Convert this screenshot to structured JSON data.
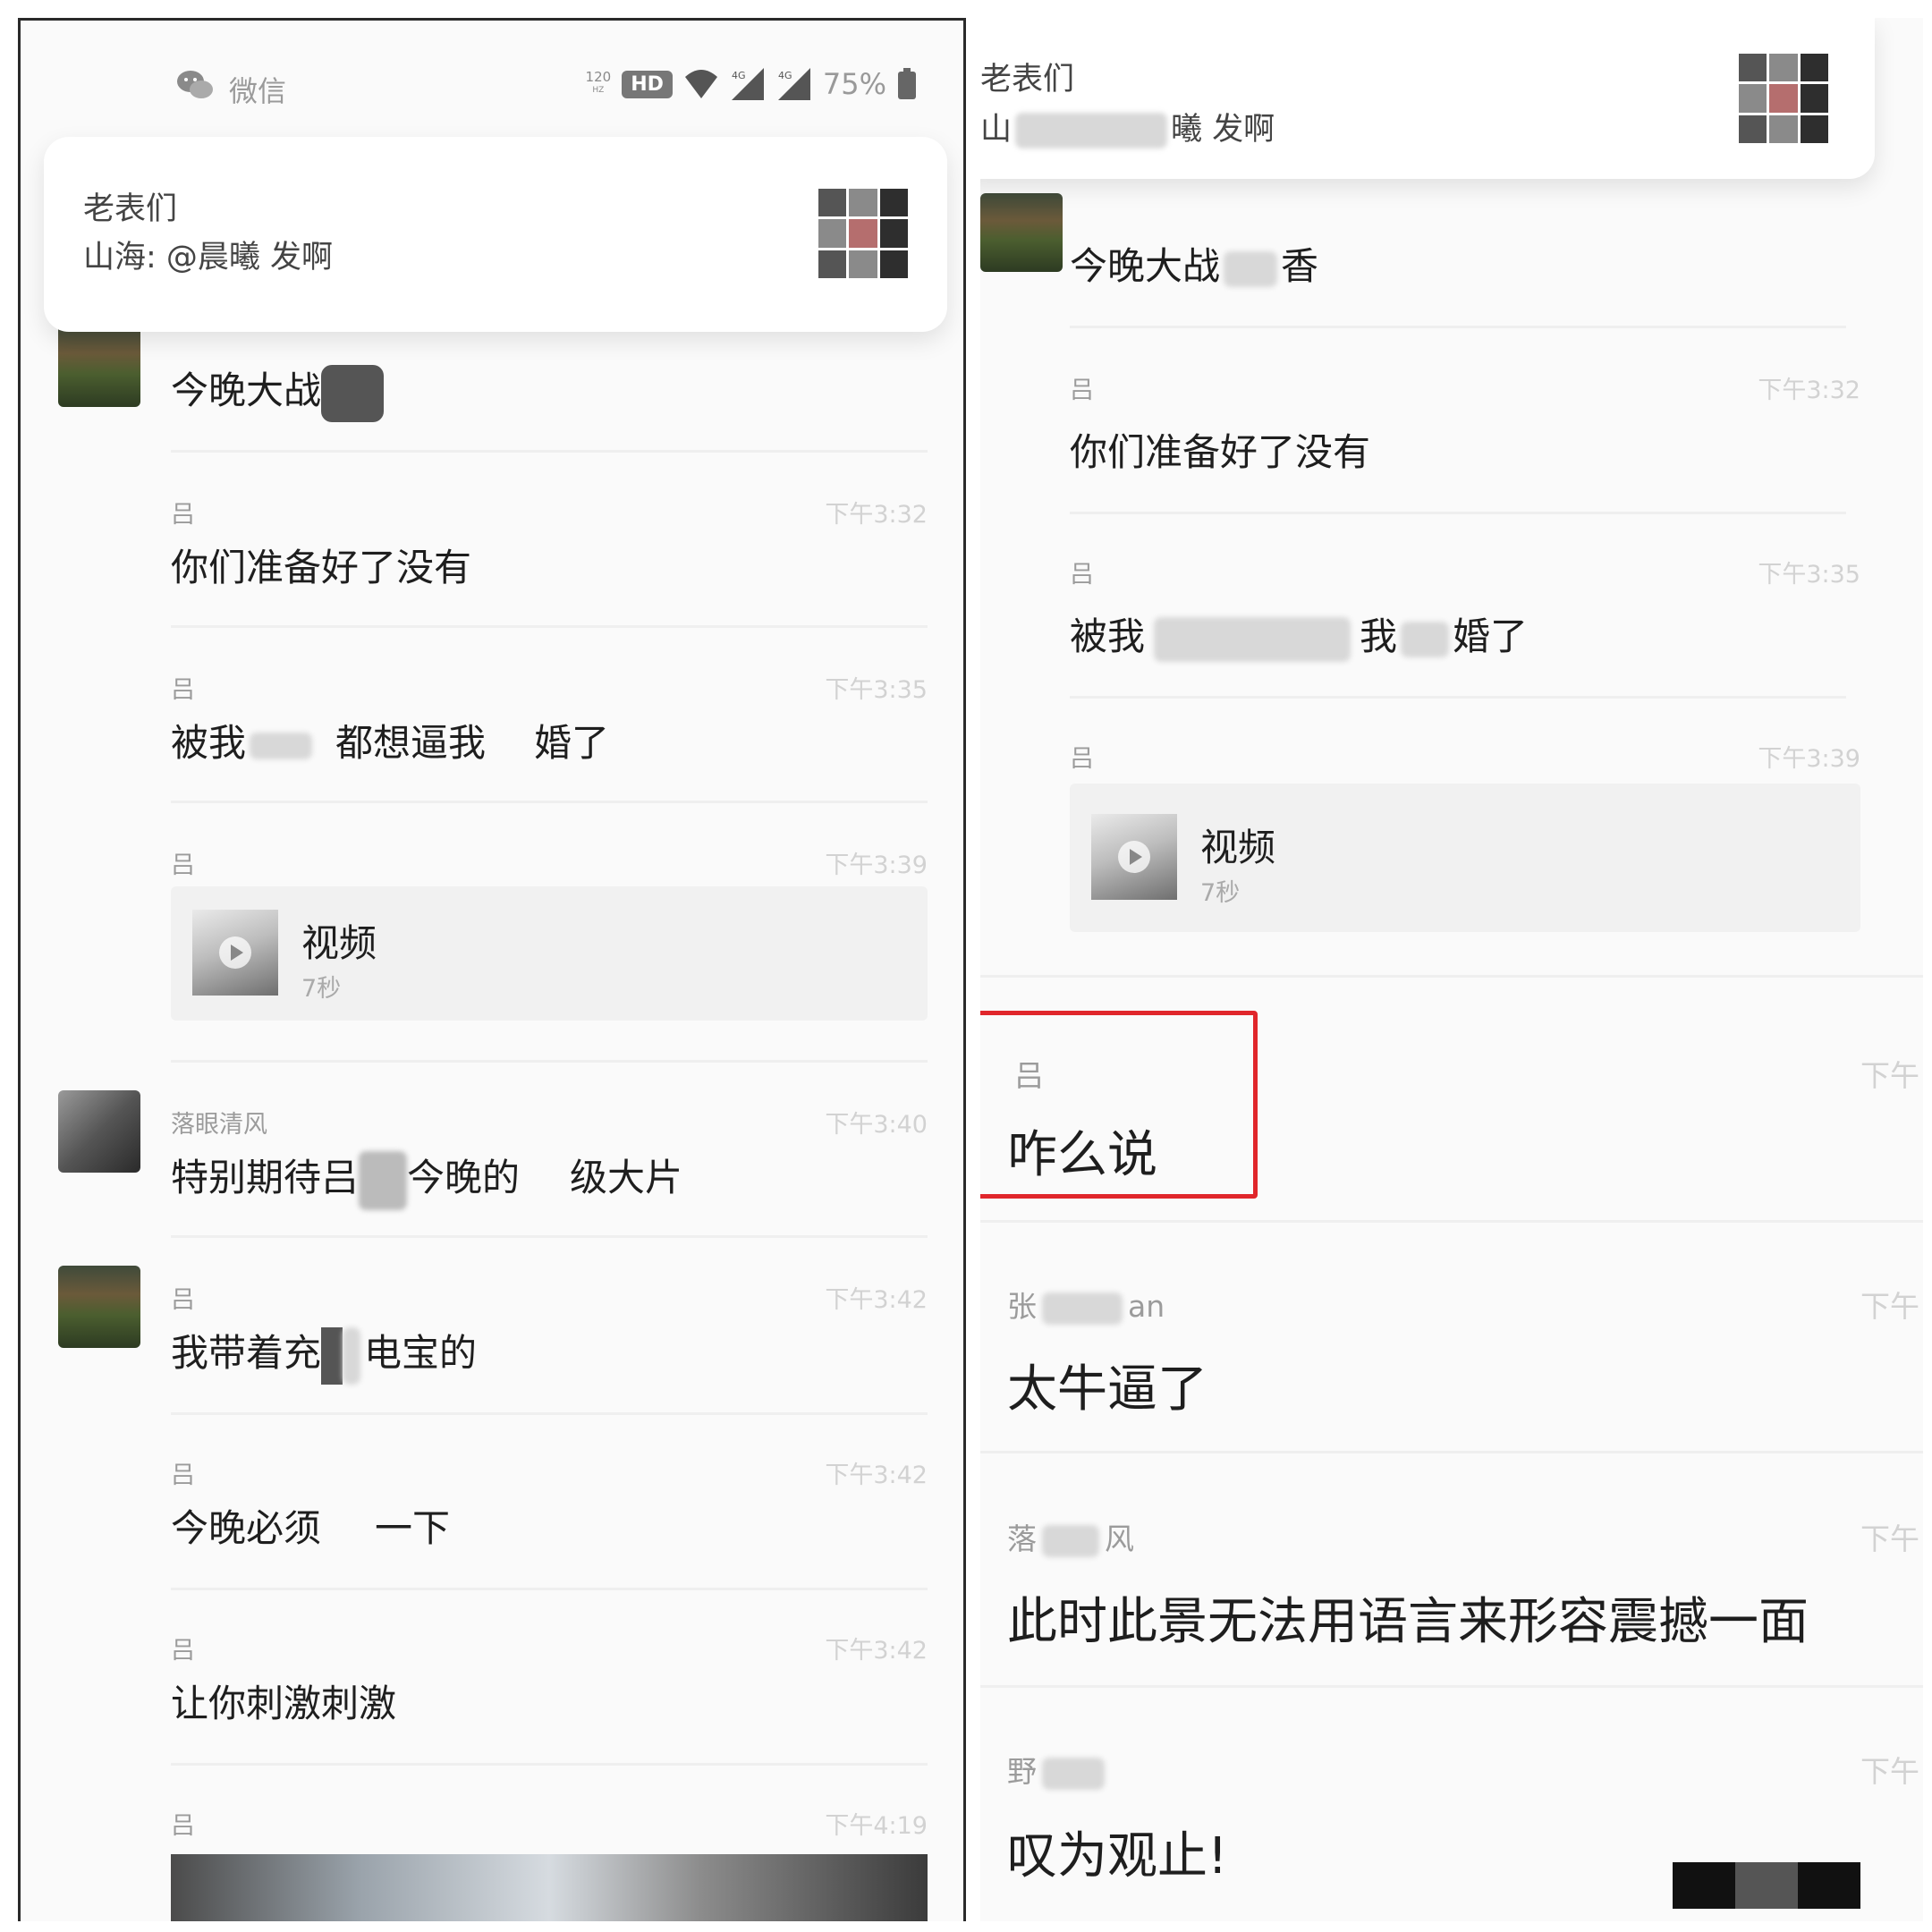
{
  "status_bar": {
    "app_name": "微信",
    "refresh_rate": "120",
    "refresh_unit": "HZ",
    "hd_label": "HD",
    "network_1": "4G",
    "network_2": "4G",
    "battery": "75%"
  },
  "notification": {
    "title": "老表们",
    "message": "山海: @晨曦 发啊"
  },
  "right_notification": {
    "title": "老表们",
    "message_prefix": "山",
    "message_suffix": "曦 发啊"
  },
  "left_messages": [
    {
      "sender": "吕",
      "time": "下午3:32",
      "text_a": "今晚大战",
      "text_b": ""
    },
    {
      "sender": "吕",
      "time": "下午3:32",
      "text_a": "你们准备好了没有",
      "text_b": ""
    },
    {
      "sender": "吕",
      "time": "下午3:35",
      "text_a": "被我",
      "text_b": "都想逼我",
      "text_c": "婚了"
    },
    {
      "sender": "吕",
      "time": "下午3:39",
      "video_label": "视频",
      "video_duration": "7秒"
    },
    {
      "sender": "落眼清风",
      "time": "下午3:40",
      "text_a": "特别期待吕",
      "text_b": "今晚的",
      "text_c": "级大片"
    },
    {
      "sender": "吕",
      "time": "下午3:42",
      "text_a": "我带着充",
      "text_b": "电宝的"
    },
    {
      "sender": "吕",
      "time": "下午3:42",
      "text_a": "今晚必须",
      "text_b": "一下"
    },
    {
      "sender": "吕",
      "time": "下午3:42",
      "text_a": "让你刺激刺激"
    },
    {
      "sender": "吕",
      "time": "下午4:19"
    }
  ],
  "right_messages": [
    {
      "text_a": "今晚大战",
      "text_b": "香"
    },
    {
      "sender": "吕",
      "time": "下午3:32",
      "text_a": "你们准备好了没有"
    },
    {
      "sender": "吕",
      "time": "下午3:35",
      "text_a": "被我",
      "text_b": "我",
      "text_c": "婚了"
    },
    {
      "sender": "吕",
      "time": "下午3:39",
      "video_label": "视频",
      "video_duration": "7秒"
    },
    {
      "sender": "吕",
      "time": "下午",
      "text_a": "咋么说"
    },
    {
      "sender_a": "张",
      "sender_b": "an",
      "time": "下午",
      "text_a": "太牛逼了"
    },
    {
      "sender_a": "落",
      "sender_b": "风",
      "time": "下午",
      "text_a": "此时此景无法用语言来形容震撼一面"
    },
    {
      "sender_a": "野",
      "time": "下午",
      "text_a": "叹为观止!"
    }
  ]
}
